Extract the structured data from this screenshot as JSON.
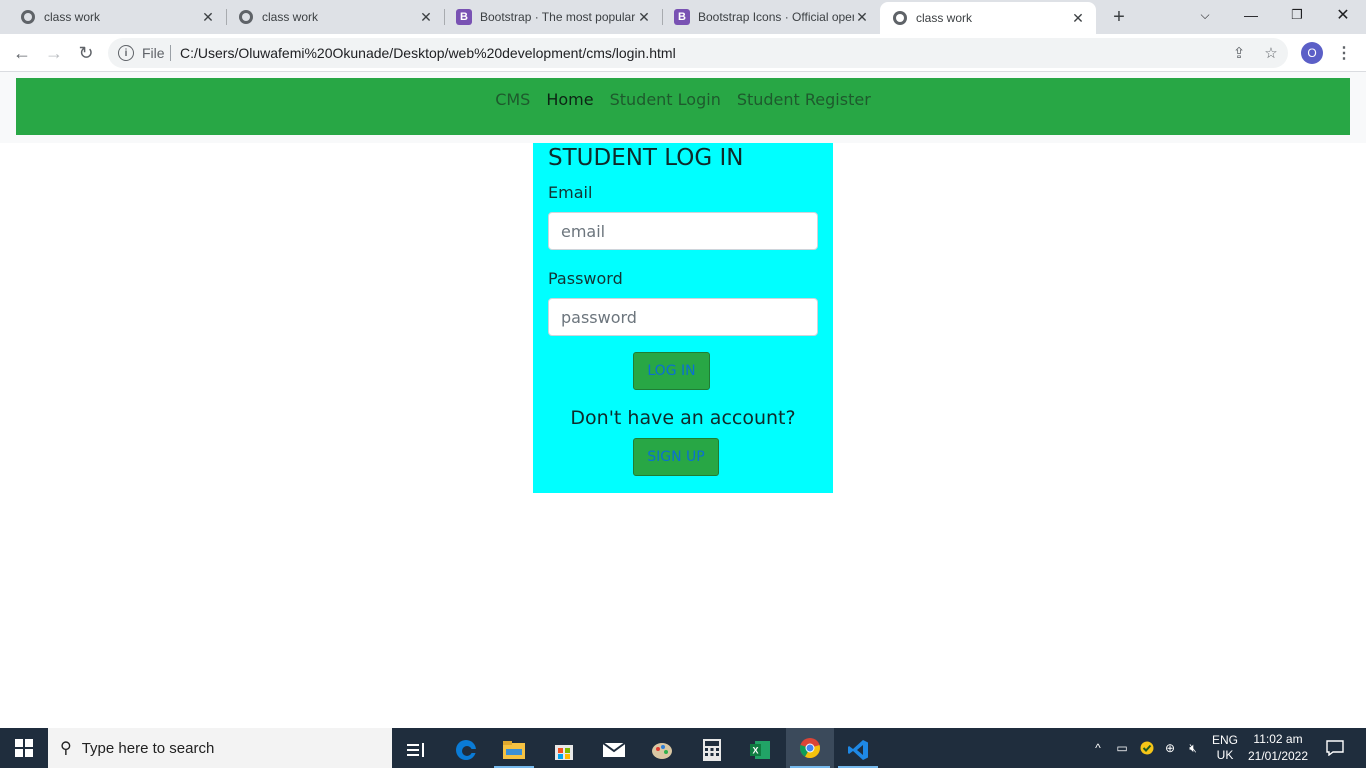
{
  "browser": {
    "tabs": [
      {
        "title": "class work",
        "icon": "globe-icon",
        "active": false
      },
      {
        "title": "class work",
        "icon": "globe-icon",
        "active": false
      },
      {
        "title": "Bootstrap · The most popular HTML, CSS, and JS library",
        "icon": "bootstrap-icon",
        "active": false
      },
      {
        "title": "Bootstrap Icons · Official open source SVG icon library",
        "icon": "bootstrap-icon",
        "active": false
      },
      {
        "title": "class work",
        "icon": "globe-icon",
        "active": true
      }
    ],
    "bootstrap_letter": "B",
    "address": {
      "scheme_label": "File",
      "url": "C:/Users/Oluwafemi%20Okunade/Desktop/web%20development/cms/login.html"
    },
    "profile_initial": "O"
  },
  "page": {
    "navbar": {
      "brand": "CMS",
      "links": [
        "Home",
        "Student Login",
        "Student Register"
      ],
      "color": "#28a745"
    },
    "login": {
      "heading": "STUDENT LOG IN",
      "email_label": "Email",
      "email_placeholder": "email",
      "password_label": "Password",
      "password_placeholder": "password",
      "login_button": "LOG IN",
      "signup_prompt": "Don't have an account?",
      "signup_button": "SIGN UP",
      "card_color": "#00ffff"
    }
  },
  "taskbar": {
    "search_placeholder": "Type here to search",
    "language_top": "ENG",
    "language_bottom": "UK",
    "time": "11:02 am",
    "date": "21/01/2022"
  }
}
